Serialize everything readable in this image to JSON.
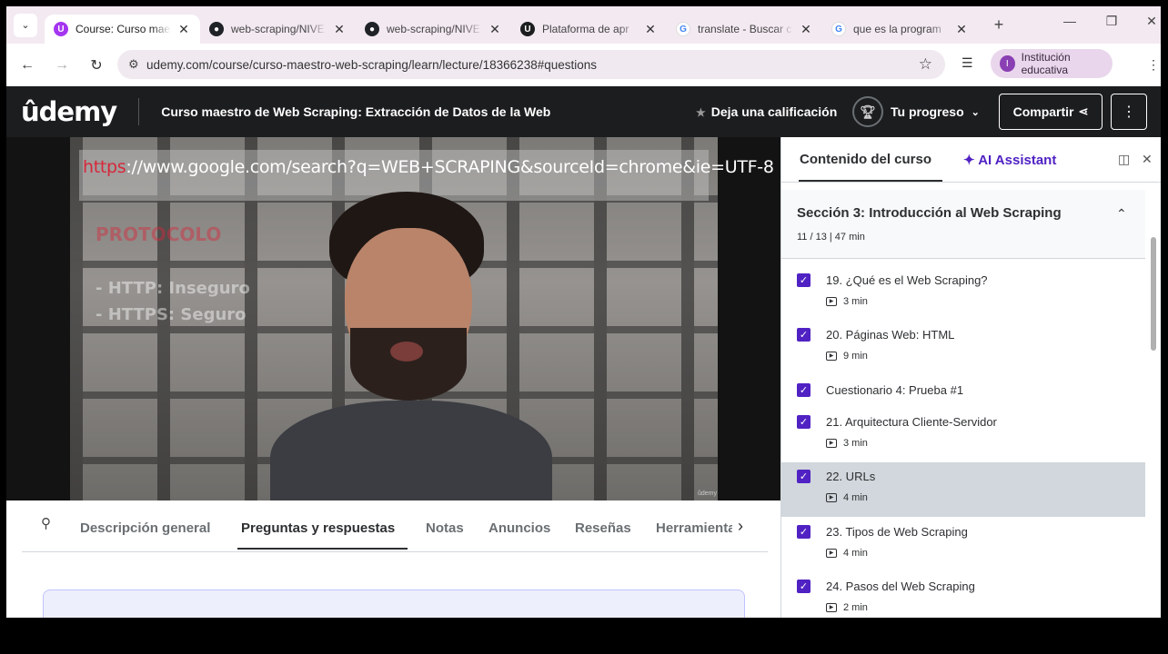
{
  "browser": {
    "tabs": [
      {
        "title": "Course: Curso maes",
        "icon": "udemy-favicon",
        "color": "#a435f0",
        "active": true
      },
      {
        "title": "web-scraping/NIVE",
        "icon": "github-icon",
        "color": "#1f2328",
        "active": false
      },
      {
        "title": "web-scraping/NIVE",
        "icon": "github-icon",
        "color": "#1f2328",
        "active": false
      },
      {
        "title": "Plataforma de apr",
        "icon": "udemy-favicon",
        "color": "#1c1d1f",
        "active": false
      },
      {
        "title": "translate - Buscar c",
        "icon": "google-icon",
        "color": "#4285f4",
        "active": false
      },
      {
        "title": "que es la program",
        "icon": "google-icon",
        "color": "#4285f4",
        "active": false
      }
    ],
    "url": "udemy.com/course/curso-maestro-web-scraping/learn/lecture/18366238#questions",
    "profile_label": "Institución educativa",
    "profile_initial": "I"
  },
  "header": {
    "logo": "ûdemy",
    "course_title": "Curso maestro de Web Scraping: Extracción de Datos de la Web",
    "rate_label": "Deja una calificación",
    "progress_label": "Tu progreso",
    "share_label": "Compartir"
  },
  "video": {
    "url_protocol": "https",
    "url_rest": "://www.google.com/search?q=WEB+SCRAPING&sourceId=chrome&ie=UTF-8",
    "overlay_title": "PROTOCOLO",
    "overlay_line1": "- HTTP: Inseguro",
    "overlay_line2": "- HTTPS: Seguro",
    "watermark": "ûdemy"
  },
  "subtabs": {
    "items": [
      "Descripción general",
      "Preguntas y respuestas",
      "Notas",
      "Anuncios",
      "Reseñas",
      "Herramientas"
    ],
    "active_index": 1
  },
  "sidebar": {
    "tab_content": "Contenido del curso",
    "tab_ai": "AI Assistant",
    "section_title": "Sección 3: Introducción al Web Scraping",
    "section_meta": "11 / 13 | 47 min",
    "items": [
      {
        "label": "19. ¿Qué es el Web Scraping?",
        "duration": "3 min",
        "checked": true,
        "selected": false
      },
      {
        "label": "20. Páginas Web: HTML",
        "duration": "9 min",
        "checked": true,
        "selected": false
      },
      {
        "label": "Cuestionario 4: Prueba #1",
        "duration": "",
        "checked": true,
        "selected": false
      },
      {
        "label": "21. Arquitectura Cliente-Servidor",
        "duration": "3 min",
        "checked": true,
        "selected": false
      },
      {
        "label": "22. URLs",
        "duration": "4 min",
        "checked": true,
        "selected": true
      },
      {
        "label": "23. Tipos de Web Scraping",
        "duration": "4 min",
        "checked": true,
        "selected": false
      },
      {
        "label": "24. Pasos del Web Scraping",
        "duration": "2 min",
        "checked": true,
        "selected": false
      }
    ]
  },
  "colors": {
    "udemy_purple": "#5022c3",
    "header_bg": "#1c1d1f"
  }
}
